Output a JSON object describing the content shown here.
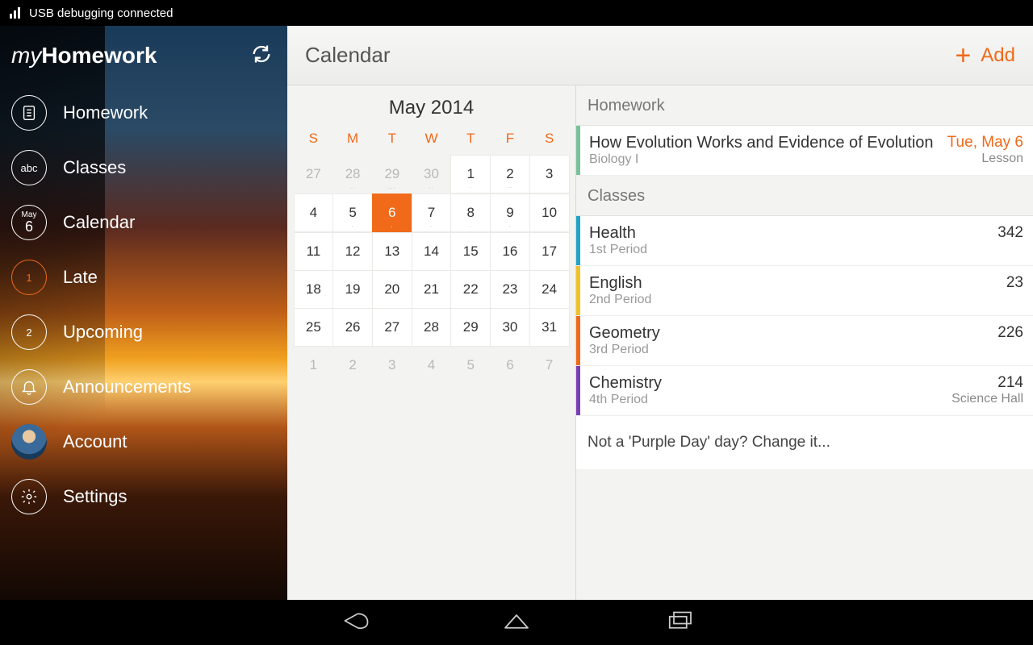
{
  "statusbar": {
    "text": "USB debugging connected"
  },
  "brand": {
    "my": "my",
    "homework": "Homework"
  },
  "sidebar": {
    "items": [
      {
        "label": "Homework"
      },
      {
        "label": "Classes",
        "badge": "abc"
      },
      {
        "label": "Calendar",
        "month": "May",
        "day": "6"
      },
      {
        "label": "Late",
        "badge": "1"
      },
      {
        "label": "Upcoming",
        "badge": "2"
      },
      {
        "label": "Announcements"
      },
      {
        "label": "Account"
      },
      {
        "label": "Settings"
      }
    ]
  },
  "topbar": {
    "title": "Calendar",
    "add": "Add"
  },
  "calendar": {
    "title": "May 2014",
    "dow": [
      "S",
      "M",
      "T",
      "W",
      "T",
      "F",
      "S"
    ],
    "cells": [
      {
        "n": "27",
        "dim": true
      },
      {
        "n": "28",
        "dim": true,
        "dots": ".."
      },
      {
        "n": "29",
        "dim": true,
        "dots": "..."
      },
      {
        "n": "30",
        "dim": true,
        "dots": ".."
      },
      {
        "n": "1",
        "dots": "."
      },
      {
        "n": "2",
        "dots": ".."
      },
      {
        "n": "3"
      },
      {
        "n": "4"
      },
      {
        "n": "5",
        "dots": "."
      },
      {
        "n": "6",
        "sel": true,
        "dots": "."
      },
      {
        "n": "7",
        "dots": "."
      },
      {
        "n": "8",
        "dots": "."
      },
      {
        "n": "9",
        "dots": "."
      },
      {
        "n": "10"
      },
      {
        "n": "11"
      },
      {
        "n": "12"
      },
      {
        "n": "13"
      },
      {
        "n": "14"
      },
      {
        "n": "15"
      },
      {
        "n": "16"
      },
      {
        "n": "17"
      },
      {
        "n": "18"
      },
      {
        "n": "19"
      },
      {
        "n": "20"
      },
      {
        "n": "21"
      },
      {
        "n": "22"
      },
      {
        "n": "23"
      },
      {
        "n": "24"
      },
      {
        "n": "25"
      },
      {
        "n": "26"
      },
      {
        "n": "27"
      },
      {
        "n": "28"
      },
      {
        "n": "29"
      },
      {
        "n": "30"
      },
      {
        "n": "31"
      },
      {
        "n": "1",
        "dim": true
      },
      {
        "n": "2",
        "dim": true
      },
      {
        "n": "3",
        "dim": true
      },
      {
        "n": "4",
        "dim": true
      },
      {
        "n": "5",
        "dim": true
      },
      {
        "n": "6",
        "dim": true
      },
      {
        "n": "7",
        "dim": true
      }
    ],
    "inmonth_start": 4,
    "inmonth_end": 34
  },
  "sections": {
    "homework": "Homework",
    "classes": "Classes"
  },
  "homework_item": {
    "title": "How Evolution Works and Evidence of Evolution",
    "sub": "Biology I",
    "when": "Tue, May 6",
    "type": "Lesson",
    "color": "#7ac29a"
  },
  "classes": [
    {
      "name": "Health",
      "period": "1st Period",
      "room": "342",
      "loc": "",
      "color": "#1fa3c8"
    },
    {
      "name": "English",
      "period": "2nd Period",
      "room": "23",
      "loc": "",
      "color": "#f0c22a"
    },
    {
      "name": "Geometry",
      "period": "3rd Period",
      "room": "226",
      "loc": "",
      "color": "#f06a1a"
    },
    {
      "name": "Chemistry",
      "period": "4th Period",
      "room": "214",
      "loc": "Science Hall",
      "color": "#7a3fb5"
    }
  ],
  "footer_note": "Not a 'Purple Day' day?  Change it..."
}
